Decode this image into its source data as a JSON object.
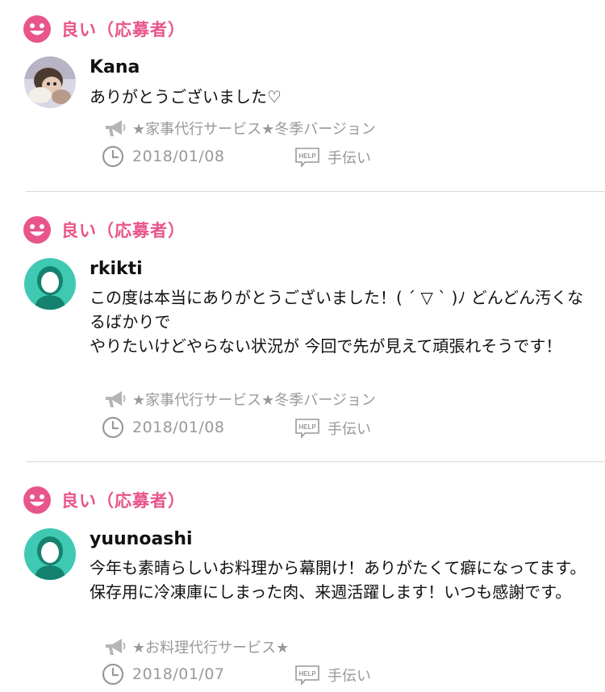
{
  "colors": {
    "accent": "#e8558a",
    "muted": "#999999",
    "avatar_teal": "#3fc9b3",
    "divider": "#d9d9d9"
  },
  "icons": {
    "rating": "smiley-face-icon",
    "service": "megaphone-icon",
    "date": "clock-icon",
    "category": "help-tag-icon"
  },
  "reviews": [
    {
      "rating": "良い（応募者）",
      "username": "Kana",
      "comment": "ありがとうございました♡",
      "service": "★家事代行サービス★冬季バージョン",
      "date": "2018/01/08",
      "category": "手伝い",
      "help_tag": "HELP"
    },
    {
      "rating": "良い（応募者）",
      "username": "rkikti",
      "comment": "この度は本当にありがとうございました！( ´ ▽ ` )ﾉ どんどん汚くなるばかりで\nやりたいけどやらない状況が  今回で先が見えて頑張れそうです！",
      "service": "★家事代行サービス★冬季バージョン",
      "date": "2018/01/08",
      "category": "手伝い",
      "help_tag": "HELP"
    },
    {
      "rating": "良い（応募者）",
      "username": "yuunoashi",
      "comment": "今年も素晴らしいお料理から幕開け！ありがたくて癖になってます。保存用に冷凍庫にしまった肉、来週活躍します！いつも感謝です。",
      "service": "★お料理代行サービス★",
      "date": "2018/01/07",
      "category": "手伝い",
      "help_tag": "HELP"
    }
  ]
}
